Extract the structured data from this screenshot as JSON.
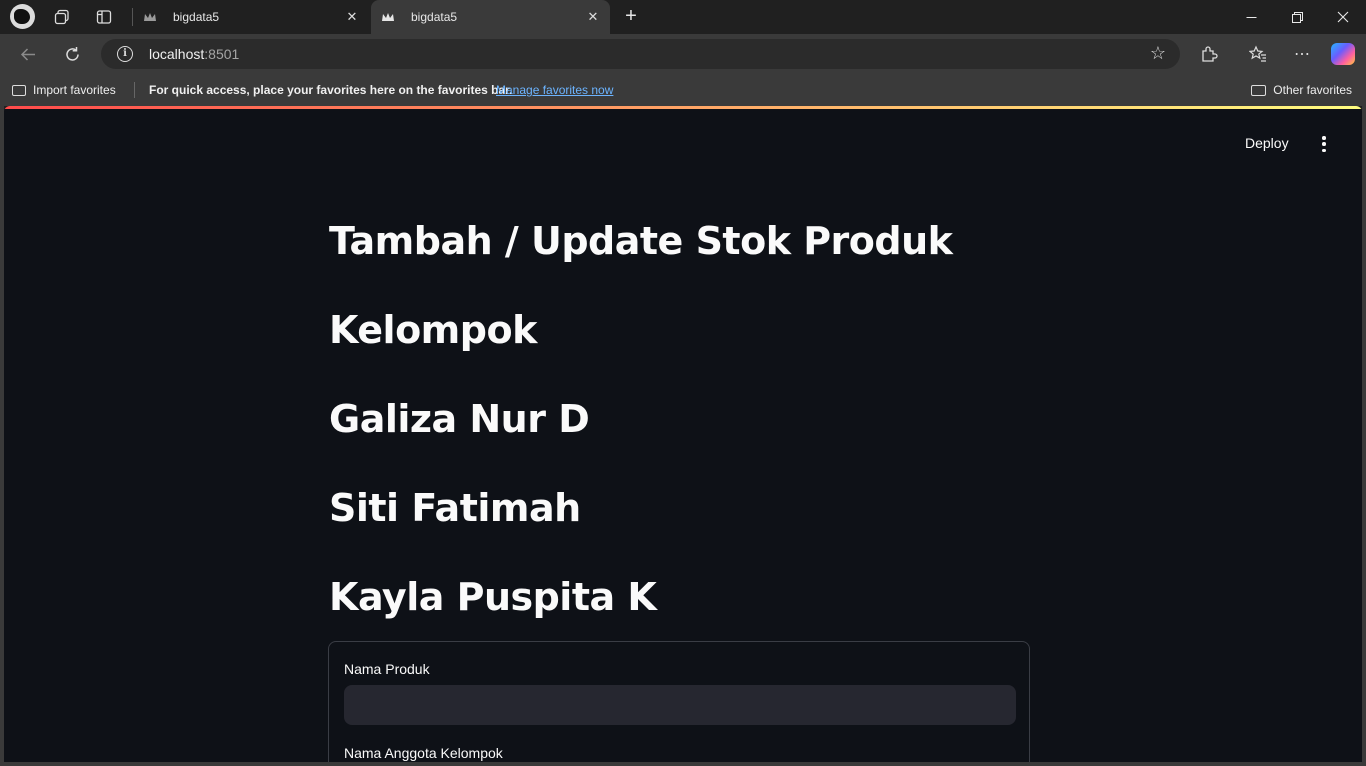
{
  "browser": {
    "tabs": [
      {
        "title": "bigdata5",
        "active": false
      },
      {
        "title": "bigdata5",
        "active": true
      }
    ],
    "address": {
      "host": "localhost",
      "port": ":8501"
    },
    "favorites_bar": {
      "import_label": "Import favorites",
      "message": "For quick access, place your favorites here on the favorites bar.",
      "manage_link": "Manage favorites now",
      "other_label": "Other favorites"
    }
  },
  "app": {
    "deploy_label": "Deploy",
    "headings": [
      "Tambah / Update Stok Produk",
      "Kelompok",
      "Galiza Nur D",
      "Siti Fatimah",
      "Kayla Puspita K"
    ],
    "form": {
      "product_name_label": "Nama Produk",
      "product_name_value": "",
      "members_label": "Nama Anggota Kelompok"
    },
    "colors": {
      "background": "#0e1117",
      "input_bg": "#262730",
      "accent": "#ff4b4b"
    }
  }
}
